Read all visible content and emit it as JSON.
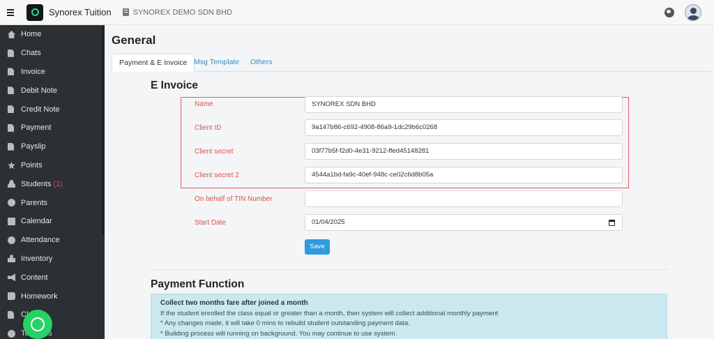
{
  "header": {
    "app_title": "Synorex Tuition",
    "company_name": "SYNOREX DEMO SDN BHD"
  },
  "sidebar": {
    "items": [
      {
        "label": "Home",
        "icon": "home-icon"
      },
      {
        "label": "Chats",
        "icon": "document-icon"
      },
      {
        "label": "Invoice",
        "icon": "document-icon"
      },
      {
        "label": "Debit Note",
        "icon": "document-icon"
      },
      {
        "label": "Credit Note",
        "icon": "document-icon"
      },
      {
        "label": "Payment",
        "icon": "document-icon"
      },
      {
        "label": "Payslip",
        "icon": "document-icon"
      },
      {
        "label": "Points",
        "icon": "star-icon"
      },
      {
        "label": "Students",
        "icon": "users-icon",
        "badge": "(1)"
      },
      {
        "label": "Parents",
        "icon": "user-circle-icon"
      },
      {
        "label": "Calendar",
        "icon": "calendar-icon"
      },
      {
        "label": "Attendance",
        "icon": "clock-icon"
      },
      {
        "label": "Inventory",
        "icon": "boxes-icon"
      },
      {
        "label": "Content",
        "icon": "megaphone-icon"
      },
      {
        "label": "Homework",
        "icon": "book-icon"
      },
      {
        "label": "Cl",
        "icon": "document-icon"
      },
      {
        "label": "Teachers",
        "icon": "user-icon"
      }
    ]
  },
  "page": {
    "title": "General",
    "tabs": [
      {
        "label": "Payment & E Invoice",
        "active": true
      },
      {
        "label": "Msg Template",
        "active": false
      },
      {
        "label": "Others",
        "active": false
      }
    ]
  },
  "einvoice": {
    "title": "E Invoice",
    "name_label": "Name",
    "name_value": "SYNOREX SDN BHD",
    "client_id_label": "Client ID",
    "client_id_value": "9a147b86-c692-4908-86a9-1dc29b6c0268",
    "client_secret_label": "Client secret",
    "client_secret_value": "03f77b5f-f2d0-4e31-9212-ffed45148281",
    "client_secret2_label": "Client secret 2",
    "client_secret2_value": "4544a1bd-fa9c-40ef-948c-ce02c6d8b05a",
    "tin_label": "On behalf of TIN Number",
    "tin_value": "",
    "start_date_label": "Start Date",
    "start_date_value": "01/04/2025",
    "save_label": "Save"
  },
  "payment_function": {
    "title": "Payment Function",
    "info_title": "Collect two months fare after joined a month",
    "info_line1": "If the student enrolled the class equal or greater than a month, then system will collect additional monthly payment",
    "info_line2": "* Any changes made, it will take 0 mins to rebuild student outstanding payment data.",
    "info_line3": "* Building process will running on background. You may continue to use system."
  },
  "colors": {
    "sidebar_bg": "#2b3035",
    "accent": "#2d9bdc",
    "label_red": "#d9534f",
    "highlight_border": "#e15b63",
    "info_bg": "#cbe8ef",
    "whatsapp": "#25d366"
  }
}
